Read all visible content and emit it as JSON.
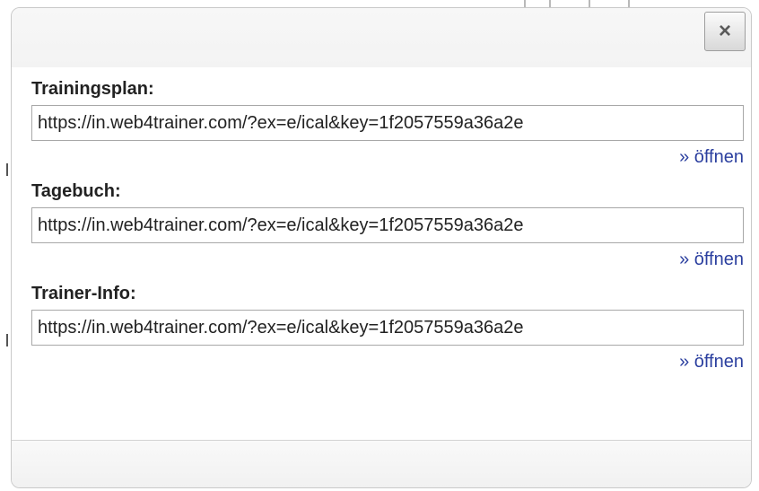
{
  "dialog": {
    "close_label": "×",
    "sections": [
      {
        "label": "Trainingsplan:",
        "url": "https://in.web4trainer.com/?ex=e/ical&key=1f2057559a36a2e",
        "open_link": "» öffnen"
      },
      {
        "label": "Tagebuch:",
        "url": "https://in.web4trainer.com/?ex=e/ical&key=1f2057559a36a2e",
        "open_link": "» öffnen"
      },
      {
        "label": "Trainer-Info:",
        "url": "https://in.web4trainer.com/?ex=e/ical&key=1f2057559a36a2e",
        "open_link": "» öffnen"
      }
    ]
  },
  "colors": {
    "link": "#2b3f9f",
    "field_border": "#a8a8a8",
    "header_bg": "#f5f5f5"
  }
}
